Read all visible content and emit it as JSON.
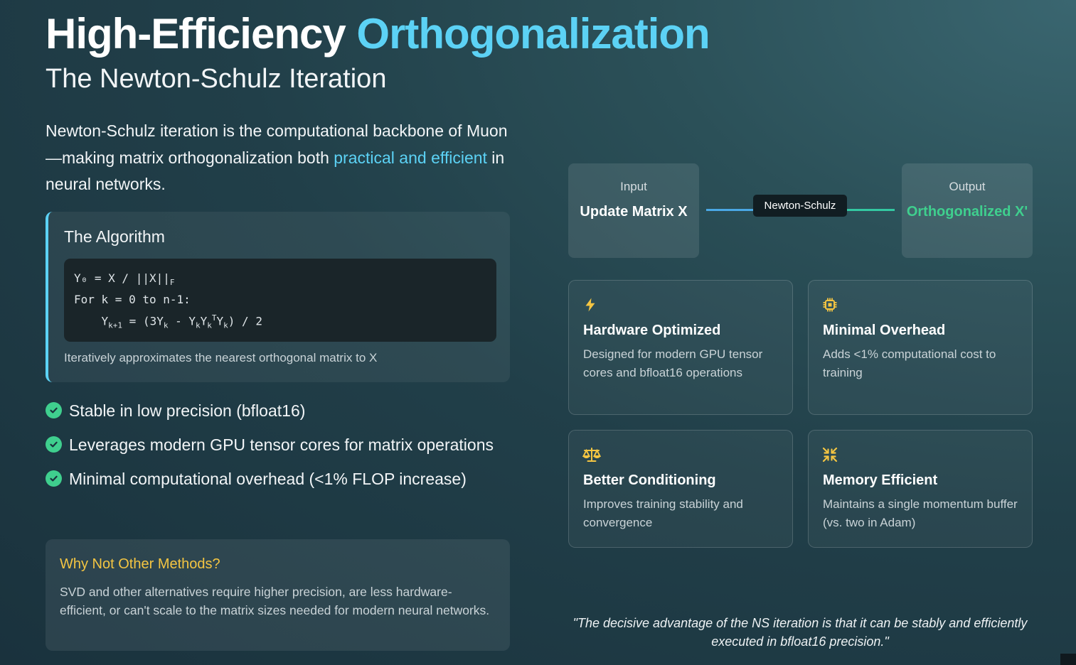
{
  "header": {
    "title_main": "High-Efficiency",
    "title_accent": "Orthogonalization",
    "subtitle": "The Newton-Schulz Iteration"
  },
  "intro": {
    "text_before": "Newton-Schulz iteration is the computational backbone of Muon—making matrix orthogonalization both ",
    "highlight": "practical and efficient",
    "text_after": " in neural networks."
  },
  "algorithm": {
    "title": "The Algorithm",
    "caption": "Iteratively approximates the nearest orthogonal matrix to X"
  },
  "checklist": [
    "Stable in low precision (bfloat16)",
    "Leverages modern GPU tensor cores for matrix operations",
    "Minimal computational overhead (<1% FLOP increase)"
  ],
  "why": {
    "title": "Why Not Other Methods?",
    "text": "SVD and other alternatives require higher precision, are less hardware-efficient, or can't scale to the matrix sizes needed for modern neural networks."
  },
  "flow": {
    "input_label": "Input",
    "input_value": "Update Matrix X",
    "process_label": "Newton-Schulz",
    "output_label": "Output",
    "output_value": "Orthogonalized X'"
  },
  "features": [
    {
      "icon": "bolt-icon",
      "title": "Hardware Optimized",
      "desc": "Designed for modern GPU tensor cores and bfloat16 operations"
    },
    {
      "icon": "chip-icon",
      "title": "Minimal Overhead",
      "desc": "Adds <1% computational cost to training"
    },
    {
      "icon": "balance-scale-icon",
      "title": "Better Conditioning",
      "desc": "Improves training stability and convergence"
    },
    {
      "icon": "compress-icon",
      "title": "Memory Efficient",
      "desc": "Maintains a single momentum buffer (vs. two in Adam)"
    }
  ],
  "quote": "\"The decisive advantage of the NS iteration is that it can be stably and efficiently executed in bfloat16 precision.\"",
  "colors": {
    "accent_cyan": "#5cd2f5",
    "accent_green": "#3fcf8e",
    "accent_yellow": "#f4c542"
  }
}
